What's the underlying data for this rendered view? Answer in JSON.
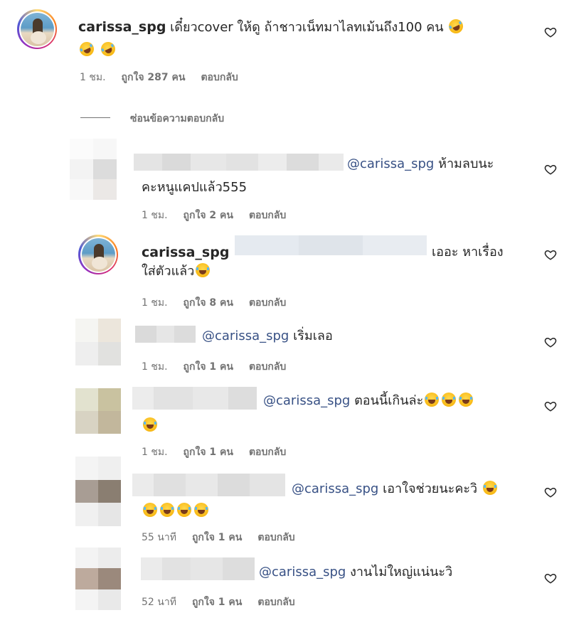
{
  "top_comment": {
    "username": "carissa_spg",
    "text": "เดี๋ยวcover ให้ดู ถ้าชาวเน็ทมาไลทเม้นถึง100 คน",
    "time": "1 ชม.",
    "likes": "ถูกใจ 287 คน",
    "reply": "ตอบกลับ"
  },
  "hide_replies_label": "ซ่อนข้อความตอบกลับ",
  "replies": [
    {
      "mention": "@carissa_spg",
      "text_line1": "ห้ามลบนะ",
      "text_line2": "คะหนูแคปแล้ว555",
      "time": "1 ชม.",
      "likes": "ถูกใจ 2 คน",
      "reply": "ตอบกลับ"
    },
    {
      "username": "carissa_spg",
      "text_line1": "เออะ หาเรื่อง",
      "text_line2": "ใส่ตัวแล้ว",
      "time": "1 ชม.",
      "likes": "ถูกใจ 8 คน",
      "reply": "ตอบกลับ"
    },
    {
      "mention": "@carissa_spg",
      "text_line1": "เริ่มเลอ",
      "time": "1 ชม.",
      "likes": "ถูกใจ 1 คน",
      "reply": "ตอบกลับ"
    },
    {
      "mention": "@carissa_spg",
      "text_line1": "ตอนนี้เกินล่ะ",
      "time": "1 ชม.",
      "likes": "ถูกใจ 1 คน",
      "reply": "ตอบกลับ"
    },
    {
      "mention": "@carissa_spg",
      "text_line1": "เอาใจช่วยนะคะวิ",
      "time": "55 นาที",
      "likes": "ถูกใจ 1 คน",
      "reply": "ตอบกลับ"
    },
    {
      "mention": "@carissa_spg",
      "text_line1": "งานไม่ใหญ่แน่นะวิ",
      "time": "52 นาที",
      "likes": "ถูกใจ 1 คน",
      "reply": "ตอบกลับ"
    }
  ],
  "icons": {
    "like": "heart-outline-icon",
    "emoji_rofl": "rolling-on-floor-laughing-emoji",
    "emoji_joy": "face-with-tears-of-joy-emoji"
  }
}
